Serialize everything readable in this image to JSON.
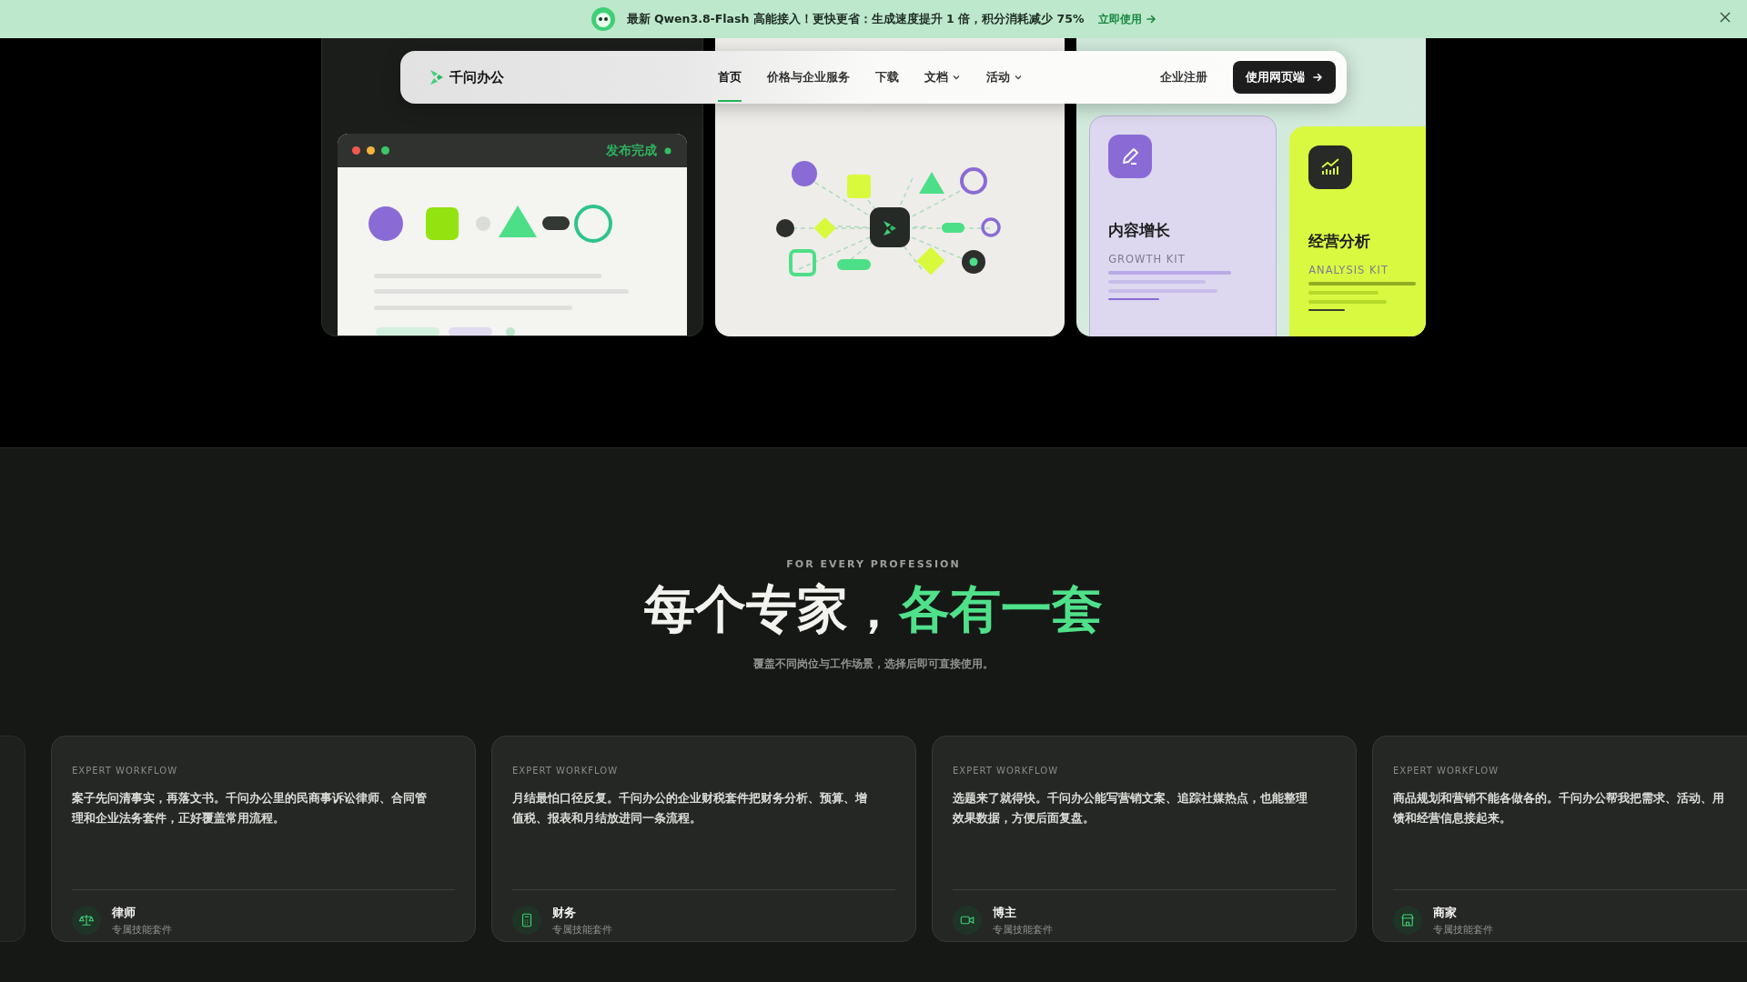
{
  "banner": {
    "message": "最新 Qwen3.8-Flash 高能接入！更快更省：生成速度提升 1 倍，积分消耗减少 75%",
    "link": "立即使用"
  },
  "nav": {
    "brand": "千问办公",
    "items": [
      {
        "label": "首页",
        "selected": true,
        "dropdown": false
      },
      {
        "label": "价格与企业服务",
        "selected": false,
        "dropdown": false
      },
      {
        "label": "下载",
        "selected": false,
        "dropdown": false
      },
      {
        "label": "文档",
        "selected": false,
        "dropdown": true
      },
      {
        "label": "活动",
        "selected": false,
        "dropdown": true
      }
    ],
    "secondary_link": "企业注册",
    "cta": "使用网页端"
  },
  "hero": {
    "publish_window": {
      "status": "发布完成"
    },
    "kits": [
      {
        "kind": "pencil",
        "title": "内容增长",
        "subtitle": "GROWTH KIT",
        "color": "#ddd8ef"
      },
      {
        "kind": "chart",
        "title": "经营分析",
        "subtitle": "ANALYSIS KIT",
        "color": "#d9f941"
      }
    ]
  },
  "section": {
    "eyebrow": "FOR EVERY PROFESSION",
    "heading": "每个专家，",
    "heading_highlight": "各有一套",
    "subtitle": "覆盖不同岗位与工作场景，选择后即可直接使用。"
  },
  "cards": [
    {
      "kind": "scale",
      "eyebrow": "EXPERT WORKFLOW",
      "lines": [
        "案子先问清事实，再落文书。千问办公里的民商事诉讼律师、合同管",
        "理和企业法务套件，正好覆盖常用流程。"
      ],
      "role": "律师",
      "caption": "专属技能套件"
    },
    {
      "kind": "calculator",
      "eyebrow": "EXPERT WORKFLOW",
      "lines": [
        "月结最怕口径反复。千问办公的企业财税套件把财务分析、预算、增",
        "值税、报表和月结放进同一条流程。"
      ],
      "role": "财务",
      "caption": "专属技能套件"
    },
    {
      "kind": "camera",
      "eyebrow": "EXPERT WORKFLOW",
      "lines": [
        "选题来了就得快。千问办公能写营销文案、追踪社媒热点，也能整理",
        "效果数据，方便后面复盘。"
      ],
      "role": "博主",
      "caption": "专属技能套件"
    },
    {
      "kind": "store",
      "eyebrow": "EXPERT WORKFLOW",
      "lines": [
        "商品规划和营销不能各做各的。千问办公帮我把需求、活动、用",
        "馈和经营信息接起来。"
      ],
      "role": "商家",
      "caption": "专属技能套件"
    }
  ]
}
